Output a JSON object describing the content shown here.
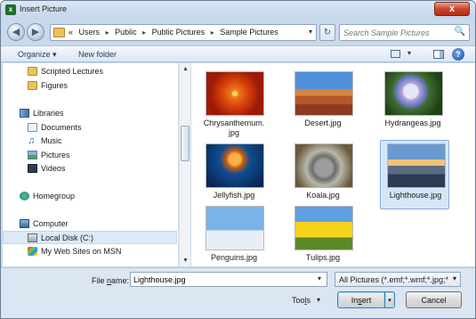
{
  "window": {
    "title": "Insert Picture",
    "close_label": "x"
  },
  "address": {
    "overflow": "«",
    "crumbs": [
      "Users",
      "Public",
      "Public Pictures",
      "Sample Pictures"
    ],
    "separator": "▸",
    "dropdown": "▾",
    "refresh": "↻"
  },
  "search": {
    "placeholder": "Search Sample Pictures",
    "icon": "🔍"
  },
  "toolbar": {
    "organize_label": "Organize ▾",
    "new_folder_label": "New folder",
    "views_arrow": "▾",
    "help_label": "?"
  },
  "nav": {
    "items": [
      {
        "label": "Scripted Lectures",
        "icon": "folder-icon"
      },
      {
        "label": "Figures",
        "icon": "folder-icon"
      },
      {
        "label": "Libraries",
        "icon": "library-icon"
      },
      {
        "label": "Documents",
        "icon": "documents-icon"
      },
      {
        "label": "Music",
        "icon": "music-icon"
      },
      {
        "label": "Pictures",
        "icon": "pictures-icon"
      },
      {
        "label": "Videos",
        "icon": "videos-icon"
      },
      {
        "label": "Homegroup",
        "icon": "homegroup-icon"
      },
      {
        "label": "Computer",
        "icon": "computer-icon"
      },
      {
        "label": "Local Disk (C:)",
        "icon": "disk-icon"
      },
      {
        "label": "My Web Sites on MSN",
        "icon": "msn-icon"
      }
    ],
    "music_glyph": "♫"
  },
  "scrollbar": {
    "up": "▲",
    "down": "▼"
  },
  "files": [
    {
      "name": "Chrysanthemum.",
      "name2": "jpg"
    },
    {
      "name": "Desert.jpg",
      "name2": ""
    },
    {
      "name": "Hydrangeas.jpg",
      "name2": ""
    },
    {
      "name": "Jellyfish.jpg",
      "name2": ""
    },
    {
      "name": "Koala.jpg",
      "name2": ""
    },
    {
      "name": "Lighthouse.jpg",
      "name2": ""
    },
    {
      "name": "Penguins.jpg",
      "name2": ""
    },
    {
      "name": "Tulips.jpg",
      "name2": ""
    }
  ],
  "bottom": {
    "filename_label_pre": "File ",
    "filename_label_u": "n",
    "filename_label_post": "ame:",
    "filename_value": "Lighthouse.jpg",
    "filename_dd": "▾",
    "filter_value": "All Pictures (*.emf;*.wmf;*.jpg;*",
    "filter_dd": "▾",
    "tools_pre": "Too",
    "tools_u": "l",
    "tools_post": "s",
    "tools_dd": "▾",
    "insert_pre": "In",
    "insert_u": "s",
    "insert_post": "ert",
    "insert_split": "▾",
    "cancel_label": "Cancel"
  }
}
